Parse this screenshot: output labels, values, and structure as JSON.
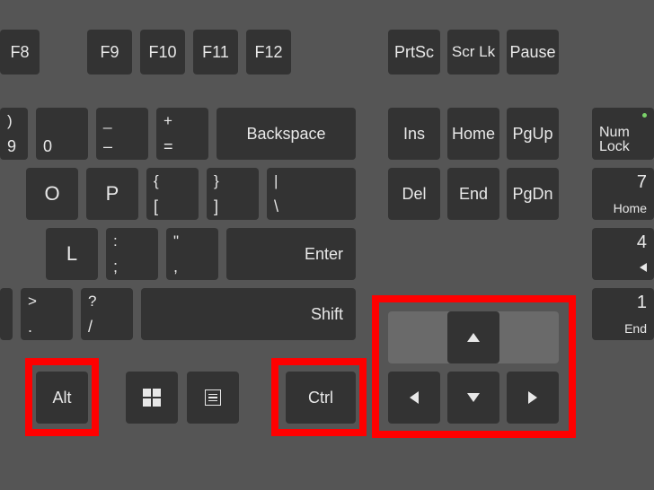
{
  "row1": {
    "f8": "F8",
    "f9": "F9",
    "f10": "F10",
    "f11": "F11",
    "f12": "F12",
    "prtsc": "PrtSc",
    "scrlk": "Scr Lk",
    "pause": "Pause"
  },
  "row2": {
    "nine": {
      "top": ")",
      "bot": "9"
    },
    "zero": {
      "top": "",
      "bot": "0"
    },
    "minus": {
      "top": "_",
      "bot": "–"
    },
    "equals": {
      "top": "+",
      "bot": "="
    },
    "backspace": "Backspace",
    "ins": "Ins",
    "home": "Home",
    "pgup": "PgUp",
    "numlock": {
      "top": "Num",
      "bot": "Lock"
    }
  },
  "row3": {
    "o": "O",
    "p": "P",
    "lbracket": {
      "top": "{",
      "bot": "["
    },
    "rbracket": {
      "top": "}",
      "bot": "]"
    },
    "backslash": {
      "top": "|",
      "bot": "\\"
    },
    "del": "Del",
    "end": "End",
    "pgdn": "PgDn",
    "num7": {
      "top": "7",
      "bot": "Home"
    }
  },
  "row4": {
    "l": "L",
    "semicolon": {
      "top": ":",
      "bot": ";"
    },
    "quote": {
      "top": "\"",
      "bot": ","
    },
    "enter": "Enter",
    "num4": {
      "top": "4",
      "bot": "◁"
    }
  },
  "row5": {
    "period": {
      "top": ">",
      "bot": "."
    },
    "slash": {
      "top": "?",
      "bot": "/"
    },
    "shift": "Shift",
    "num1": {
      "top": "1",
      "bot": "End"
    }
  },
  "row6": {
    "alt": "Alt",
    "ctrl": "Ctrl"
  },
  "icons": {
    "windows": "windows-logo",
    "menu": "context-menu"
  },
  "arrows": {
    "up": "▲",
    "down": "▼",
    "left": "◀",
    "right": "▶"
  }
}
